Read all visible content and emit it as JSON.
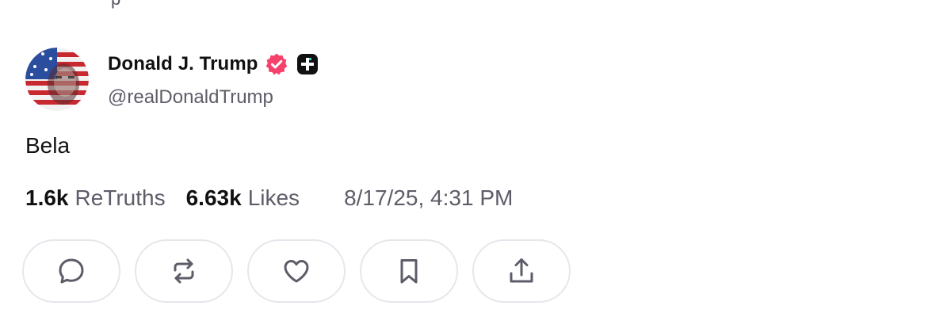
{
  "author": {
    "display_name": "Donald J. Trump",
    "handle": "@realDonaldTrump",
    "verified_badge_icon": "verified-badge-icon",
    "verified_color": "#f6416c",
    "plus_badge_icon": "plus-badge-icon"
  },
  "post": {
    "text": "Bela"
  },
  "stats": {
    "retruths_count": "1.6k",
    "retruths_label": "ReTruths",
    "likes_count": "6.63k",
    "likes_label": "Likes",
    "timestamp": "8/17/25, 4:31 PM"
  },
  "actions": [
    {
      "name": "reply",
      "icon": "comment-bubble-icon"
    },
    {
      "name": "retruth",
      "icon": "repost-arrows-icon"
    },
    {
      "name": "like",
      "icon": "heart-icon"
    },
    {
      "name": "bookmark",
      "icon": "bookmark-icon"
    },
    {
      "name": "share",
      "icon": "share-upload-icon"
    }
  ]
}
